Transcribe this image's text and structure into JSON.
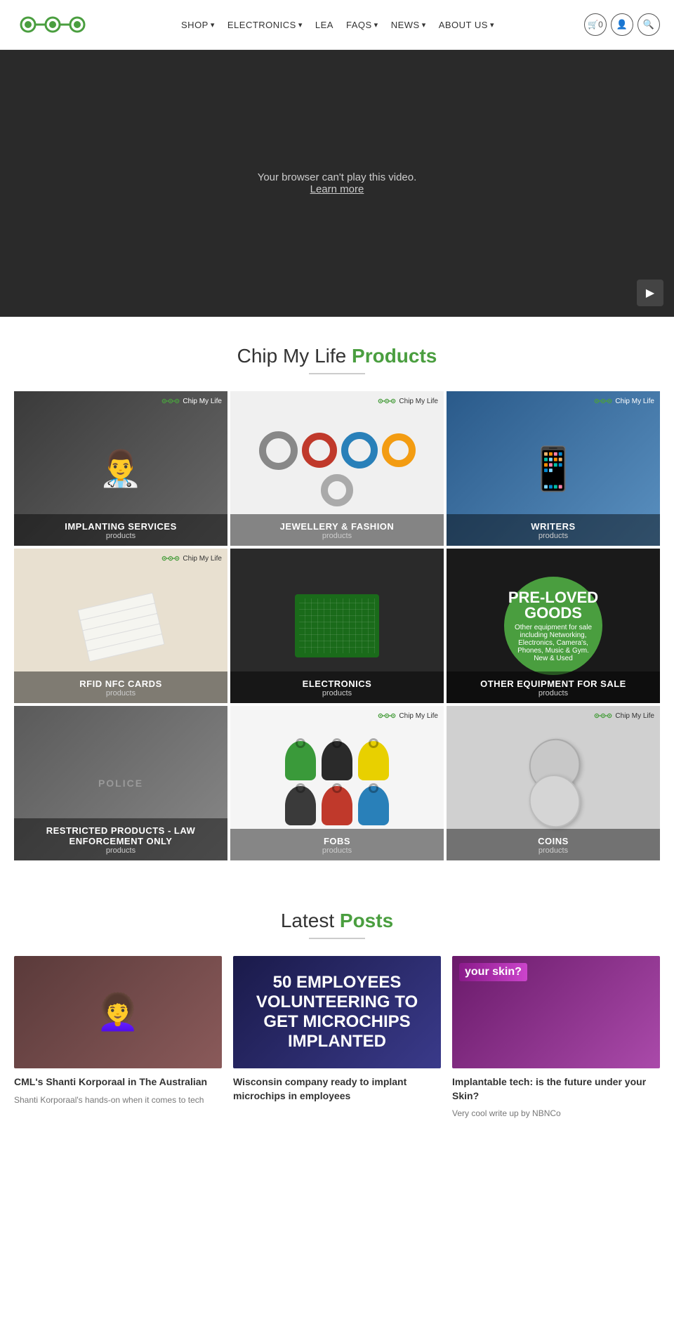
{
  "site": {
    "title": "Chip My Life"
  },
  "nav": {
    "items": [
      {
        "label": "SHOP",
        "hasDropdown": true
      },
      {
        "label": "ELECTRONICS",
        "hasDropdown": true
      },
      {
        "label": "LEA",
        "hasDropdown": false
      },
      {
        "label": "FAQS",
        "hasDropdown": true
      },
      {
        "label": "NEWS",
        "hasDropdown": true
      },
      {
        "label": "ABOUT US",
        "hasDropdown": true
      }
    ],
    "cart_count": "0"
  },
  "hero": {
    "video_message": "Your browser can't play this video.",
    "learn_more": "Learn more"
  },
  "products": {
    "section_title_plain": "Chip My Life",
    "section_title_highlight": "Products",
    "items": [
      {
        "id": "implanting",
        "name": "IMPLANTING SERVICES",
        "sub": "products",
        "bg": "bg-implanting"
      },
      {
        "id": "jewellery",
        "name": "JEWELLERY & FASHION",
        "sub": "products",
        "bg": "bg-jewellery"
      },
      {
        "id": "writers",
        "name": "WRITERS",
        "sub": "products",
        "bg": "bg-writers"
      },
      {
        "id": "rfid",
        "name": "RFID NFC CARDS",
        "sub": "products",
        "bg": "bg-rfid"
      },
      {
        "id": "electronics",
        "name": "ELECTRONICS",
        "sub": "products",
        "bg": "bg-electronics"
      },
      {
        "id": "preloved",
        "name": "OTHER EQUIPMENT FOR SALE",
        "sub": "products",
        "bg": "bg-preloved"
      },
      {
        "id": "police",
        "name": "RESTRICTED PRODUCTS - LAW ENFORCEMENT ONLY",
        "sub": "products",
        "bg": "bg-police"
      },
      {
        "id": "fobs",
        "name": "FOBS",
        "sub": "products",
        "bg": "bg-fobs"
      },
      {
        "id": "coins",
        "name": "COINS",
        "sub": "products",
        "bg": "bg-coins"
      }
    ],
    "preloved": {
      "big": "PRE-LOVED",
      "big2": "GOODS",
      "small": "Other equipment for sale including Networking, Electronics, Camera's, Phones, Music & Gym. New & Used"
    }
  },
  "posts": {
    "section_title_plain": "Latest",
    "section_title_highlight": "Posts",
    "items": [
      {
        "id": "post1",
        "title": "CML's Shanti Korporaal in The Australian",
        "excerpt": "Shanti Korporaal's hands-on when it comes to tech",
        "bg": "post-bg-1"
      },
      {
        "id": "post2",
        "title": "Wisconsin company ready to implant microchips in employees",
        "excerpt": "",
        "bg": "post-bg-2"
      },
      {
        "id": "post3",
        "title": "Implantable tech: is the future under your Skin?",
        "excerpt": "Very cool write up by NBNCo",
        "bg": "post-bg-3"
      }
    ]
  }
}
